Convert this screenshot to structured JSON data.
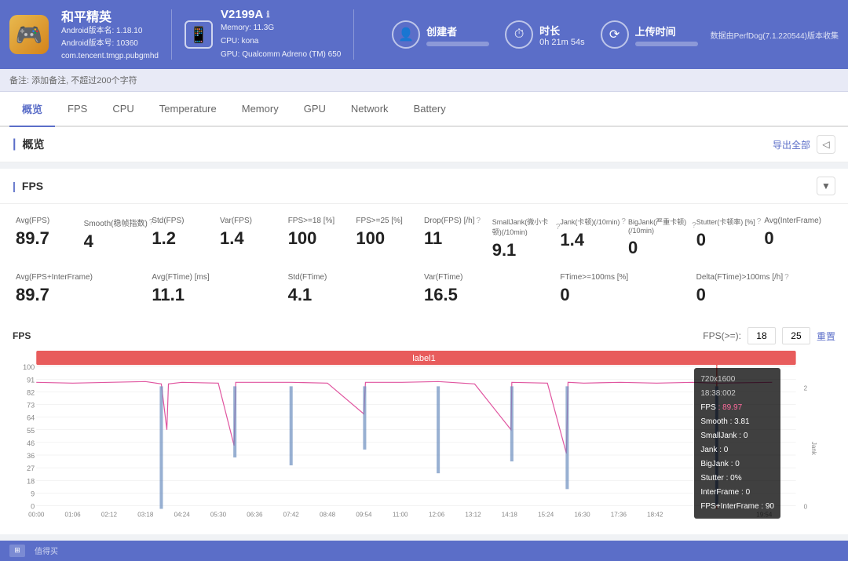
{
  "header": {
    "app_icon": "🎮",
    "app_name": "和平精英",
    "app_version1": "Android版本名: 1.18.10",
    "app_version2": "Android版本号: 10360",
    "app_package": "com.tencent.tmgp.pubgmhd",
    "device_name": "V2199A",
    "device_memory": "Memory: 11.3G",
    "device_cpu": "CPU: kona",
    "device_gpu": "GPU: Qualcomm Adreno (TM) 650",
    "creator_label": "创建者",
    "duration_label": "时长",
    "duration_value": "0h 21m 54s",
    "upload_label": "上传时间",
    "version_notice": "数据由PerfDog(7.1.220544)版本收集",
    "info_icon": "ℹ"
  },
  "notes": {
    "placeholder": "备注: 添加备注, 不超过200个字符"
  },
  "tabs": {
    "items": [
      {
        "label": "概览",
        "active": true
      },
      {
        "label": "FPS",
        "active": false
      },
      {
        "label": "CPU",
        "active": false
      },
      {
        "label": "Temperature",
        "active": false
      },
      {
        "label": "Memory",
        "active": false
      },
      {
        "label": "GPU",
        "active": false
      },
      {
        "label": "Network",
        "active": false
      },
      {
        "label": "Battery",
        "active": false
      }
    ]
  },
  "overview": {
    "title": "概览",
    "export_label": "导出全部"
  },
  "fps_section": {
    "title": "FPS",
    "collapse_icon": "▼",
    "metrics": [
      {
        "label": "Avg(FPS)",
        "value": "89.7",
        "help": false
      },
      {
        "label": "Smooth(稳帧指数)",
        "value": "4",
        "help": true
      },
      {
        "label": "Std(FPS)",
        "value": "1.2",
        "help": false
      },
      {
        "label": "Var(FPS)",
        "value": "1.4",
        "help": false
      },
      {
        "label": "FPS>=18 [%]",
        "value": "100",
        "help": false
      },
      {
        "label": "FPS>=25 [%]",
        "value": "100",
        "help": false
      },
      {
        "label": "Drop(FPS) [/h]",
        "value": "11",
        "help": true
      },
      {
        "label": "SmallJank(微小卡顿)(/10min)",
        "value": "9.1",
        "help": true
      },
      {
        "label": "Jank(卡顿)(/10min)",
        "value": "1.4",
        "help": true
      },
      {
        "label": "BigJank(严重卡顿)(/10min)",
        "value": "0",
        "help": true
      },
      {
        "label": "Stutter(卡顿率) [%]",
        "value": "0",
        "help": true
      },
      {
        "label": "Avg(InterFrame)",
        "value": "0",
        "help": false
      }
    ],
    "metrics2": [
      {
        "label": "Avg(FPS+InterFrame)",
        "value": "89.7",
        "help": false
      },
      {
        "label": "Avg(FTime) [ms]",
        "value": "11.1",
        "help": false
      },
      {
        "label": "Std(FTime)",
        "value": "4.1",
        "help": false
      },
      {
        "label": "Var(FTime)",
        "value": "16.5",
        "help": false
      },
      {
        "label": "FTime>=100ms [%]",
        "value": "0",
        "help": false
      },
      {
        "label": "Delta(FTime)>100ms [/h]",
        "value": "0",
        "help": true
      }
    ],
    "chart": {
      "fps_label": "FPS",
      "fps_gte_label": "FPS(>=):",
      "fps_val1": "18",
      "fps_val2": "25",
      "reset_label": "重置",
      "segment_label": "label1",
      "x_labels": [
        "00:00",
        "01:06",
        "02:12",
        "03:18",
        "04:24",
        "05:30",
        "06:36",
        "07:42",
        "08:48",
        "09:54",
        "11:00",
        "12:06",
        "13:12",
        "14:18",
        "15:24",
        "16:30",
        "17:36",
        "18:42",
        "",
        "",
        "19:54"
      ],
      "y_labels": [
        "100",
        "91",
        "82",
        "73",
        "64",
        "55",
        "46",
        "36",
        "27",
        "18",
        "9",
        "0"
      ],
      "jank_label": "Jank",
      "tooltip": {
        "resolution": "720x1600",
        "timestamp": "18:38:002",
        "fps_label": "FPS",
        "fps_val": "89.97",
        "smooth_label": "Smooth",
        "smooth_val": "3.81",
        "smalljank_label": "SmallJank",
        "smalljank_val": "0",
        "jank_label": "Jank",
        "jank_val": "0",
        "bigjank_label": "BigJank",
        "bigjank_val": "0",
        "stutter_label": "Stutter",
        "stutter_val": "0%",
        "interframe_label": "InterFrame",
        "interframe_val": "0",
        "fpsinter_label": "FPS+InterFrame",
        "fpsinter_val": "90"
      }
    }
  },
  "colors": {
    "accent": "#5b6ec8",
    "fps_line": "#e056a0",
    "jank_bar": "#6c8ebf",
    "segment_bg": "#e85c5c",
    "segment_text": "#fff",
    "chart_bg": "#fff",
    "grid": "#e8e8e8"
  }
}
